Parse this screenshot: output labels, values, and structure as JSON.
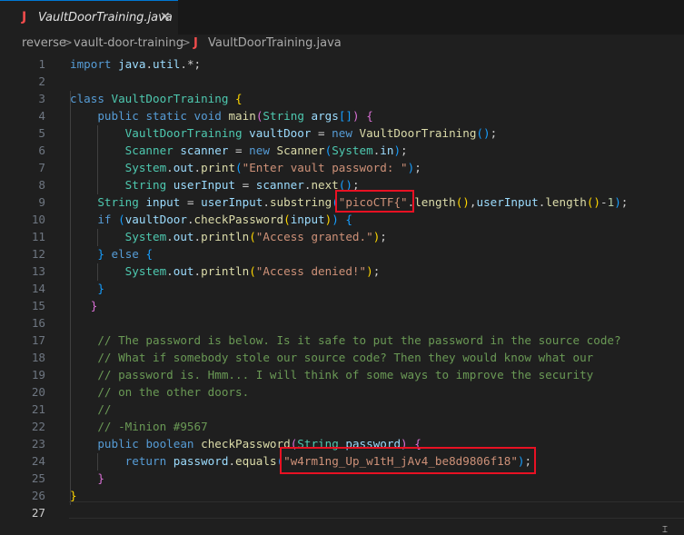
{
  "tab": {
    "icon_label": "J",
    "title": "VaultDoorTraining.java",
    "close": "✕"
  },
  "breadcrumb": {
    "items": [
      "reverse",
      "vault-door-training",
      "VaultDoorTraining.java"
    ],
    "separator": ">",
    "file_icon_label": "J"
  },
  "editor": {
    "active_line": 27,
    "lines": [
      {
        "n": "1",
        "html": "<span class=\"kw\">import</span> <span class=\"var\">java</span>.<span class=\"var\">util</span>.*;"
      },
      {
        "n": "2",
        "html": ""
      },
      {
        "n": "3",
        "html": "<span class=\"kw\">class</span> <span class=\"typ\">VaultDoorTraining</span> <span class=\"b1\">{</span>"
      },
      {
        "n": "4",
        "html": "    <span class=\"kw\">public</span> <span class=\"kw\">static</span> <span class=\"kw\">void</span> <span class=\"fn\">main</span><span class=\"b2\">(</span><span class=\"typ\">String</span> <span class=\"var\">args</span><span class=\"b3\">[]</span><span class=\"b2\">)</span> <span class=\"b2\">{</span>"
      },
      {
        "n": "5",
        "html": "        <span class=\"typ\">VaultDoorTraining</span> <span class=\"var\">vaultDoor</span> = <span class=\"kw\">new</span> <span class=\"fn\">VaultDoorTraining</span><span class=\"b3\">()</span>;"
      },
      {
        "n": "6",
        "html": "        <span class=\"typ\">Scanner</span> <span class=\"var\">scanner</span> = <span class=\"kw\">new</span> <span class=\"fn\">Scanner</span><span class=\"b3\">(</span><span class=\"typ\">System</span>.<span class=\"var\">in</span><span class=\"b3\">)</span>;"
      },
      {
        "n": "7",
        "html": "        <span class=\"typ\">System</span>.<span class=\"var\">out</span>.<span class=\"fn\">print</span><span class=\"b3\">(</span><span class=\"str\">\"Enter vault password: \"</span><span class=\"b3\">)</span>;"
      },
      {
        "n": "8",
        "html": "        <span class=\"typ\">String</span> <span class=\"var\">userInput</span> = <span class=\"var\">scanner</span>.<span class=\"fn\">next</span><span class=\"b3\">()</span>;"
      },
      {
        "n": "9",
        "html": "    <span class=\"typ\">String</span> <span class=\"var\">input</span> = <span class=\"var\">userInput</span>.<span class=\"fn\">substring</span><span class=\"b3\">(</span><span class=\"str\">\"picoCTF{\"</span>.<span class=\"fn\">length</span><span class=\"b1\">()</span>,<span class=\"var\">userInput</span>.<span class=\"fn\">length</span><span class=\"b1\">()</span>-<span class=\"num\">1</span><span class=\"b3\">)</span>;"
      },
      {
        "n": "10",
        "html": "    <span class=\"kw\">if</span> <span class=\"b3\">(</span><span class=\"var\">vaultDoor</span>.<span class=\"fn\">checkPassword</span><span class=\"b1\">(</span><span class=\"var\">input</span><span class=\"b1\">)</span><span class=\"b3\">)</span> <span class=\"b3\">{</span>"
      },
      {
        "n": "11",
        "html": "        <span class=\"typ\">System</span>.<span class=\"var\">out</span>.<span class=\"fn\">println</span><span class=\"b1\">(</span><span class=\"str\">\"Access granted.\"</span><span class=\"b1\">)</span>;"
      },
      {
        "n": "12",
        "html": "    <span class=\"b3\">}</span> <span class=\"kw\">else</span> <span class=\"b3\">{</span>"
      },
      {
        "n": "13",
        "html": "        <span class=\"typ\">System</span>.<span class=\"var\">out</span>.<span class=\"fn\">println</span><span class=\"b1\">(</span><span class=\"str\">\"Access denied!\"</span><span class=\"b1\">)</span>;"
      },
      {
        "n": "14",
        "html": "    <span class=\"b3\">}</span>"
      },
      {
        "n": "15",
        "html": "   <span class=\"b2\">}</span>"
      },
      {
        "n": "16",
        "html": ""
      },
      {
        "n": "17",
        "html": "    <span class=\"com\">// The password is below. Is it safe to put the password in the source code?</span>"
      },
      {
        "n": "18",
        "html": "    <span class=\"com\">// What if somebody stole our source code? Then they would know what our</span>"
      },
      {
        "n": "19",
        "html": "    <span class=\"com\">// password is. Hmm... I will think of some ways to improve the security</span>"
      },
      {
        "n": "20",
        "html": "    <span class=\"com\">// on the other doors.</span>"
      },
      {
        "n": "21",
        "html": "    <span class=\"com\">//</span>"
      },
      {
        "n": "22",
        "html": "    <span class=\"com\">// -Minion #9567</span>"
      },
      {
        "n": "23",
        "html": "    <span class=\"kw\">public</span> <span class=\"kw\">boolean</span> <span class=\"fn\">checkPassword</span><span class=\"b2\">(</span><span class=\"typ\">String</span> <span class=\"var\">password</span><span class=\"b2\">)</span> <span class=\"b2\">{</span>"
      },
      {
        "n": "24",
        "html": "        <span class=\"kw\">return</span> <span class=\"var\">password</span>.<span class=\"fn\">equals</span><span class=\"b3\">(</span><span class=\"str\">\"w4rm1ng_Up_w1tH_jAv4_be8d9806f18\"</span><span class=\"b3\">)</span>;"
      },
      {
        "n": "25",
        "html": "    <span class=\"b2\">}</span>"
      },
      {
        "n": "26",
        "html": "<span class=\"b1\">}</span>"
      },
      {
        "n": "27",
        "html": ""
      }
    ]
  }
}
